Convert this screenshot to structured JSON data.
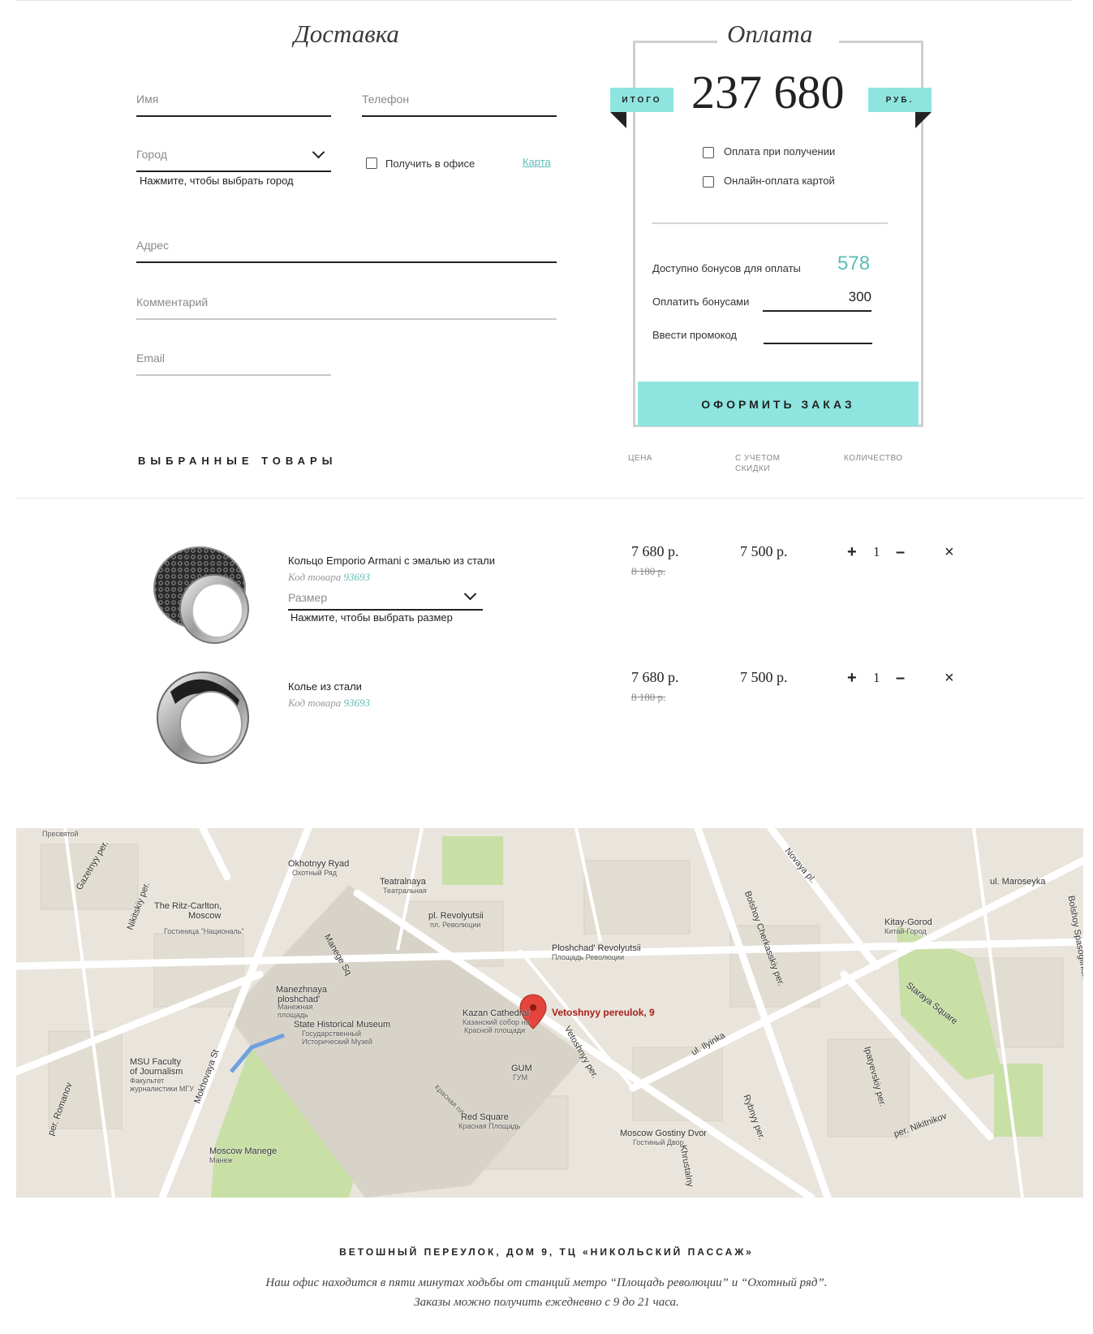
{
  "delivery": {
    "title": "Доставка",
    "name_label": "Имя",
    "phone_label": "Телефон",
    "city_label": "Город",
    "city_hint": "Нажмите, чтобы выбрать город",
    "office_checkbox": "Получить в офисе",
    "map_link": "Карта",
    "address_label": "Адрес",
    "comment_label": "Комментарий",
    "email_label": "Email"
  },
  "payment": {
    "title": "Оплата",
    "total_label": "ИТОГО",
    "total": "237 680",
    "currency": "РУБ.",
    "option_cash": "Оплата при получении",
    "option_card": "Онлайн-оплата картой",
    "bonus_available_label": "Доступно бонусов для оплаты",
    "bonus_available": "578",
    "bonus_pay_label": "Оплатить бонусами",
    "bonus_pay_value": "300",
    "promo_label": "Ввести промокод",
    "submit": "ОФОРМИТЬ ЗАКАЗ"
  },
  "goods": {
    "title": "ВЫБРАННЫЕ ТОВАРЫ",
    "col_price": "ЦЕНА",
    "col_discount": "С УЧЕТОМ СКИДКИ",
    "col_qty": "КОЛИЧЕСТВО",
    "items": [
      {
        "name": "Кольцо Emporio Armani с эмалью из стали",
        "code_label": "Код товара",
        "code": "93693",
        "size_label": "Размер",
        "size_hint": "Нажмите, чтобы выбрать размер",
        "price": "7 680 р.",
        "old_price": "8 180 р.",
        "discount_price": "7 500 р.",
        "qty": "1"
      },
      {
        "name": "Колье из стали",
        "code_label": "Код товара",
        "code": "93693",
        "price": "7 680 р.",
        "old_price": "8 180 р.",
        "discount_price": "7 500 р.",
        "qty": "1"
      }
    ],
    "plus": "+",
    "minus": "–",
    "remove": "×"
  },
  "map": {
    "marker_label": "Vetoshnyy pereulok, 9",
    "labels": [
      "Okhotnyy Ryad",
      "Охотный Ряд",
      "Teatralnaya",
      "Театральная",
      "The Ritz-Carlton,",
      "Moscow",
      "Гостиница \"Националь\"",
      "pl. Revolyutsii",
      "пл. Революции",
      "Ploshchad' Revolyutsii",
      "Площадь Революции",
      "Manezhnaya",
      "ploshchad'",
      "Манежная",
      "площадь",
      "State Historical Museum",
      "Государственный",
      "Исторический Музей",
      "Kazan Cathedral",
      "Казанский собор на",
      "Красной площади",
      "GUM",
      "ГУМ",
      "Red Square",
      "Красная Площадь",
      "MSU Faculty",
      "of Journalism",
      "Факультет",
      "журналистики МГУ",
      "Moscow Manege",
      "Манеж",
      "Moscow Gostiny Dvor",
      "Гостиный Двор",
      "Kitay-Gorod",
      "Китай-Город",
      "ul. Maroseyka",
      "ul. Ilyinka",
      "Staraya Square",
      "Novaya pl.",
      "Bolshoy Cherkasskiy per.",
      "Vetoshnyy per.",
      "Mokhovaya St",
      "Nikitskiy per.",
      "Gazetnyy per.",
      "per. Romanov",
      "Rybnyy per.",
      "Ipatyevskiy per.",
      "per. Nikitnikov",
      "Bolshoy Spasoglinishchevskiy per.",
      "Manege Sq",
      "Красная пл.",
      "Khrustalny",
      "Пресвятой"
    ],
    "colors": {
      "land": "#e9e5dc",
      "road": "#ffffff",
      "park": "#c8dfa6",
      "marker": "#e3453c"
    }
  },
  "footer": {
    "address": "ВЕТОШНЫЙ ПЕРЕУЛОК, ДОМ 9, ТЦ «НИКОЛЬСКИЙ ПАССАЖ»",
    "note_line1": "Наш офис находится в пяти минутах ходьбы от станций метро “Площадь революции” и “Охотный ряд”.",
    "note_line2": "Заказы можно получить ежедневно с 9 до 21 часа."
  },
  "colors": {
    "accent": "#8ee5e0",
    "teal_text": "#5bbcb6",
    "text": "#222222"
  }
}
